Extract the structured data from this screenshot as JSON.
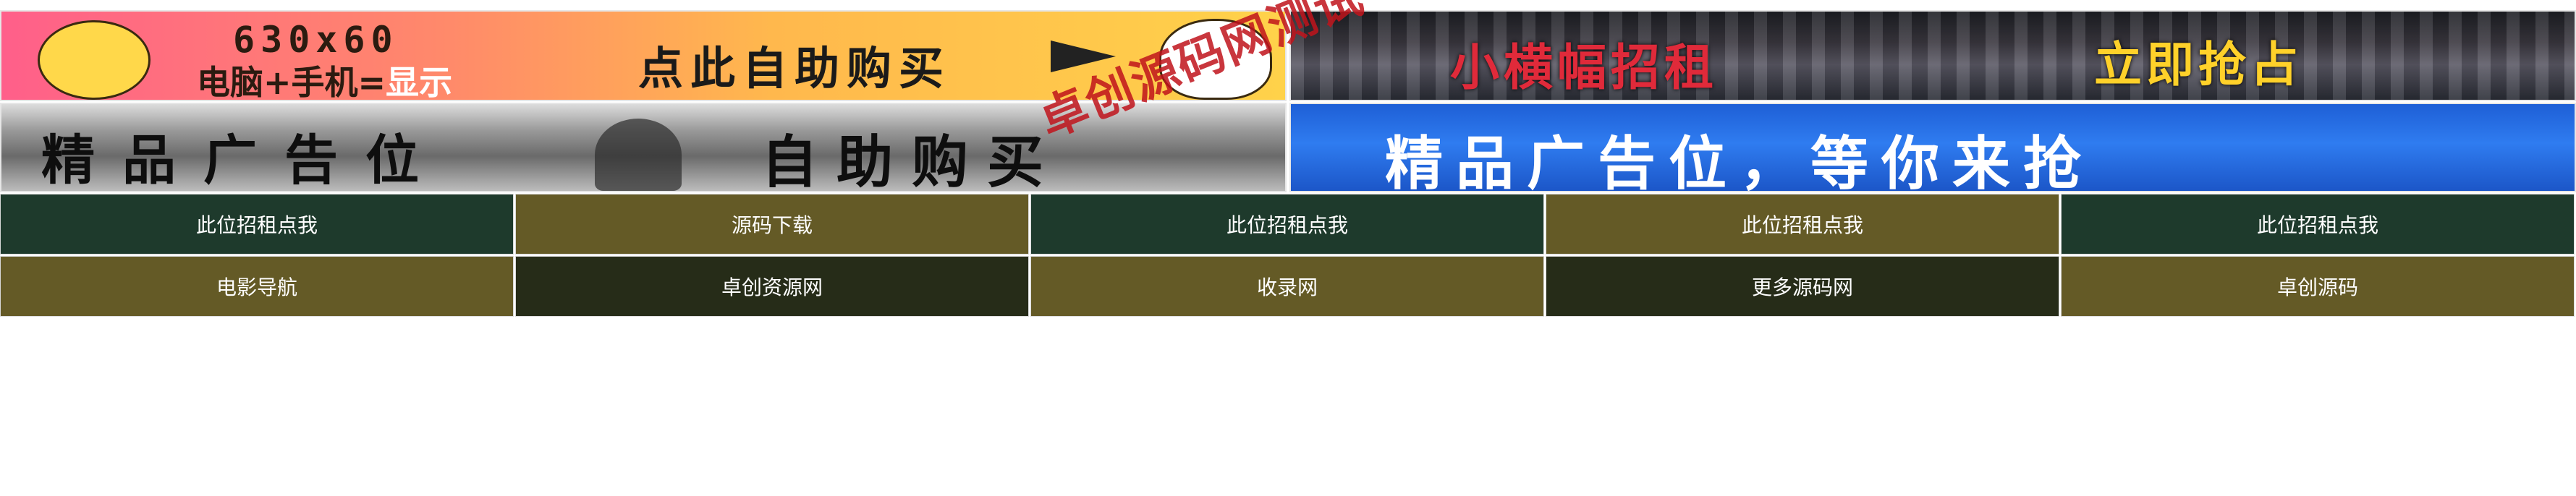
{
  "banners": {
    "b1": {
      "size_text": "630x60",
      "sub_text_a": "电脑+手机=",
      "sub_text_b": "显示",
      "buy_text": "点此自助购买"
    },
    "b2": {
      "left_text": "小横幅招租",
      "cta_text": "立即抢占"
    },
    "b3": {
      "left_text": "精品广告位",
      "right_text": "自助购买"
    },
    "b4": {
      "text": "精品广告位，等你来抢"
    }
  },
  "watermark": "卓创源码网测试",
  "nav": {
    "row1": [
      {
        "label": "此位招租点我"
      },
      {
        "label": "源码下载"
      },
      {
        "label": "此位招租点我"
      },
      {
        "label": "此位招租点我"
      },
      {
        "label": "此位招租点我"
      }
    ],
    "row2": [
      {
        "label": "电影导航"
      },
      {
        "label": "卓创资源网"
      },
      {
        "label": "收录网"
      },
      {
        "label": "更多源码网"
      },
      {
        "label": "卓创源码"
      }
    ]
  },
  "colors": {
    "nav_green": "#1e3a2c",
    "nav_olive": "#645a26",
    "nav_dark": "#262c18",
    "watermark": "#c0141c"
  }
}
